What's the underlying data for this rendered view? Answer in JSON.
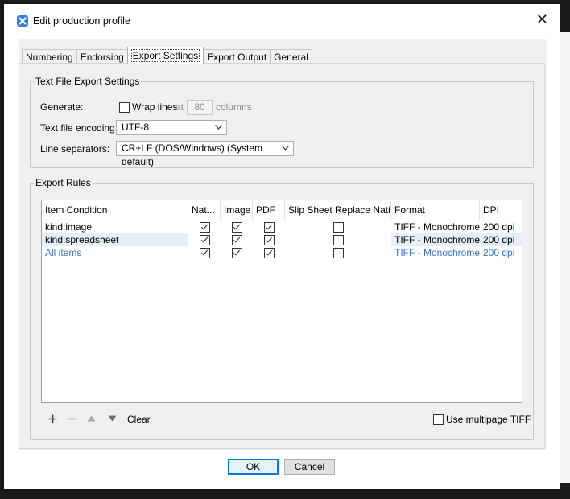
{
  "window": {
    "title": "Edit production profile"
  },
  "tabs": [
    {
      "label": "Numbering"
    },
    {
      "label": "Endorsing"
    },
    {
      "label": "Export Settings"
    },
    {
      "label": "Export Output"
    },
    {
      "label": "General"
    }
  ],
  "text_export": {
    "legend": "Text File Export Settings",
    "generate_label": "Generate:",
    "wrap_lines_label": "Wrap lines",
    "wrap_lines_checked": false,
    "at_label": "at",
    "columns_value": "80",
    "columns_label": "columns",
    "encoding_label": "Text file encoding:",
    "encoding_value": "UTF-8",
    "separators_label": "Line separators:",
    "separators_value": "CR+LF (DOS/Windows) (System default)"
  },
  "export_rules": {
    "legend": "Export Rules",
    "columns": [
      "Item Condition",
      "Nat...",
      "Image",
      "PDF",
      "Slip Sheet Replace Nati...",
      "Format",
      "DPI"
    ],
    "rows": [
      {
        "condition": "kind:image",
        "native": true,
        "image": true,
        "pdf": true,
        "slip": false,
        "format": "TIFF - Monochrome...",
        "dpi": "200 dpi"
      },
      {
        "condition": "kind:spreadsheet",
        "native": true,
        "image": true,
        "pdf": true,
        "slip": false,
        "format": "TIFF - Monochrome...",
        "dpi": "200 dpi"
      },
      {
        "condition": "All items",
        "native": true,
        "image": true,
        "pdf": true,
        "slip": false,
        "format": "TIFF - Monochrome...",
        "dpi": "200 dpi"
      }
    ],
    "clear_label": "Clear",
    "multipage_label": "Use multipage TIFF",
    "multipage_checked": false
  },
  "buttons": {
    "ok": "OK",
    "cancel": "Cancel"
  },
  "colors": {
    "default_button_border": "#0078d7",
    "link_blue": "#3a73c2",
    "selected_row": "#e5eef9"
  }
}
